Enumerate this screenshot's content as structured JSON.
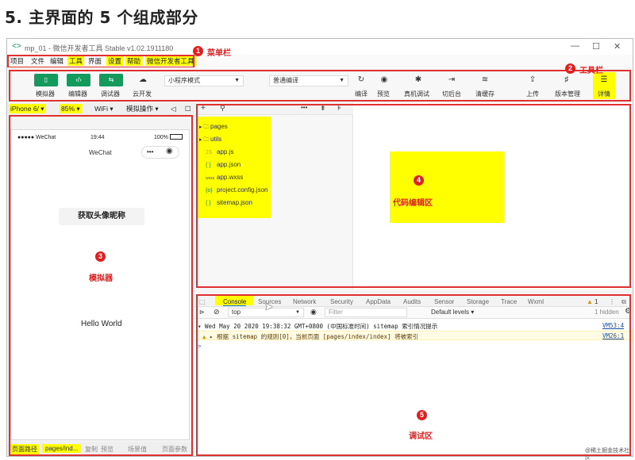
{
  "heading": "5. 主界面的 5 个组成部分",
  "window": {
    "title": "mp_01 - 微信开发者工具 Stable v1.02.1911180",
    "controls": [
      "—",
      "☐",
      "✕"
    ]
  },
  "menubar": {
    "items": [
      "项目",
      "文件",
      "编辑",
      "工具",
      "界面",
      "设置",
      "帮助",
      "微信开发者工具"
    ],
    "highlighted": [
      false,
      false,
      false,
      true,
      false,
      true,
      true,
      true
    ]
  },
  "annotations": [
    {
      "num": "1",
      "label": "菜单栏"
    },
    {
      "num": "2",
      "label": "工具栏"
    },
    {
      "num": "3",
      "label": "模拟器"
    },
    {
      "num": "4",
      "label": "代码编辑区"
    },
    {
      "num": "5",
      "label": "调试区"
    }
  ],
  "toolbar": {
    "left_buttons": [
      {
        "icon": "▯",
        "label": "模拟器"
      },
      {
        "icon": "‹/›",
        "label": "编辑器"
      },
      {
        "icon": "⇆",
        "label": "调试器"
      }
    ],
    "cloud": {
      "icon": "☁",
      "label": "云开发"
    },
    "mode_select": "小程序模式",
    "compile_select": "普通编译",
    "right_buttons": [
      {
        "icon": "↻",
        "label": "编译"
      },
      {
        "icon": "◉",
        "label": "预览"
      },
      {
        "icon": "✱",
        "label": "真机调试"
      },
      {
        "icon": "⇥",
        "label": "切后台"
      },
      {
        "icon": "≋",
        "label": "清缓存"
      },
      {
        "icon": "⇪",
        "label": "上传"
      },
      {
        "icon": "♯",
        "label": "版本管理"
      },
      {
        "icon": "☰",
        "label": "详情"
      }
    ]
  },
  "simulator": {
    "device": "iPhone 6/",
    "zoom": "85%",
    "network": "WiFi",
    "operation": "模拟操作",
    "status_left": "●●●●● WeChat",
    "status_time": "19:44",
    "status_battery": "100%",
    "nav_title": "WeChat",
    "nav_more": "•••",
    "button_text": "获取头像昵称",
    "hello": "Hello World",
    "footer": [
      "页面路径",
      "pages/ind...",
      "复制",
      "预览",
      "场景值",
      "页面参数"
    ]
  },
  "editor": {
    "toolbar_icons": [
      "+",
      "⚲",
      "•••",
      "⇟",
      "⊧"
    ],
    "files": [
      {
        "icon": "▸ 🗀",
        "name": "pages",
        "color": "#333"
      },
      {
        "icon": "▸ 🗀",
        "name": "utils",
        "color": "#333"
      },
      {
        "icon": "JS",
        "name": "app.js",
        "color": "#d6a400"
      },
      {
        "icon": "{ }",
        "name": "app.json",
        "color": "#2a8b2a"
      },
      {
        "icon": "wxss",
        "name": "app.wxss",
        "color": "#555"
      },
      {
        "icon": "{o}",
        "name": "project.config.json",
        "color": "#2a8b2a"
      },
      {
        "icon": "{ }",
        "name": "sitemap.json",
        "color": "#2a8b2a"
      }
    ]
  },
  "debug": {
    "tabs": [
      "Console",
      "Sources",
      "Network",
      "Security",
      "AppData",
      "Audits",
      "Sensor",
      "Storage",
      "Trace",
      "Wxml"
    ],
    "warn_count": "1",
    "context": "top",
    "filter_placeholder": "Filter",
    "levels": "Default levels",
    "hidden": "1 hidden",
    "log1": "Wed May 20 2020 19:38:32 GMT+0800 (中国标准时间) sitemap 索引情况提示",
    "log1_src": "VM53:4",
    "log2": "根据 sitemap 的规则[0]，当前页面 [pages/index/index] 将被索引",
    "log2_src": "VM26:1",
    "watermark": "@稀土掘金技术社区"
  },
  "colors": {
    "highlight": "#ffff00",
    "annotation_red": "#e02020",
    "wechat_green": "#159a5e"
  }
}
